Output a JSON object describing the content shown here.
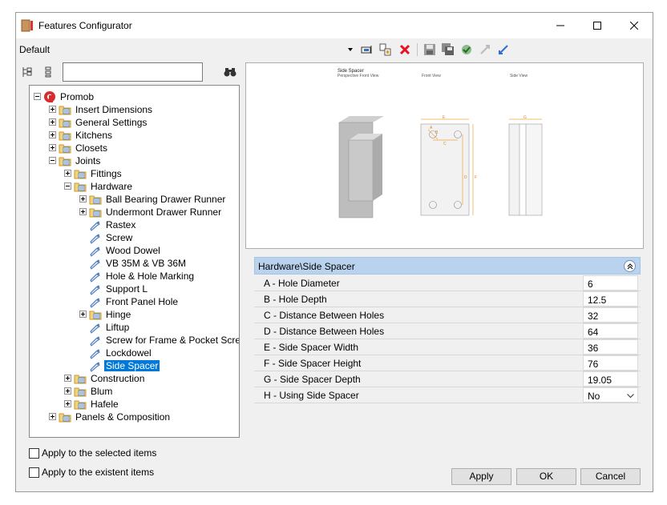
{
  "window": {
    "title": "Features Configurator",
    "minimize_icon": "minimize-icon",
    "maximize_icon": "maximize-icon",
    "close_icon": "close-icon"
  },
  "toolbar": {
    "profile": "Default",
    "icons": [
      "dropdown-arrow-icon",
      "add-icon",
      "copy-icon",
      "delete-icon",
      "save-icon",
      "save-all-icon",
      "check-icon",
      "collapse-icon",
      "expand-icon"
    ]
  },
  "left_toolbar": {
    "icons": [
      "tree-expand-icon",
      "tree-list-icon",
      "binoculars-icon"
    ],
    "search_value": ""
  },
  "tree": {
    "items": [
      {
        "label": "Promob",
        "level": 0,
        "expander": "minus",
        "icon": "promob-icon"
      },
      {
        "label": "Insert Dimensions",
        "level": 1,
        "expander": "plus",
        "icon": "folder-icon"
      },
      {
        "label": "General Settings",
        "level": 1,
        "expander": "plus",
        "icon": "folder-icon"
      },
      {
        "label": "Kitchens",
        "level": 1,
        "expander": "plus",
        "icon": "folder-icon"
      },
      {
        "label": "Closets",
        "level": 1,
        "expander": "plus",
        "icon": "folder-icon"
      },
      {
        "label": "Joints",
        "level": 1,
        "expander": "minus",
        "icon": "folder-icon"
      },
      {
        "label": "Fittings",
        "level": 2,
        "expander": "plus",
        "icon": "folder-icon"
      },
      {
        "label": "Hardware",
        "level": 2,
        "expander": "minus",
        "icon": "folder-icon"
      },
      {
        "label": "Ball Bearing Drawer Runner",
        "level": 3,
        "expander": "plus",
        "icon": "folder-icon"
      },
      {
        "label": "Undermont Drawer Runner",
        "level": 3,
        "expander": "plus",
        "icon": "folder-icon"
      },
      {
        "label": "Rastex",
        "level": 3,
        "expander": "",
        "icon": "tag-icon"
      },
      {
        "label": "Screw",
        "level": 3,
        "expander": "",
        "icon": "tag-icon"
      },
      {
        "label": "Wood Dowel",
        "level": 3,
        "expander": "",
        "icon": "tag-icon"
      },
      {
        "label": "VB 35M & VB 36M",
        "level": 3,
        "expander": "",
        "icon": "tag-icon"
      },
      {
        "label": "Hole & Hole Marking",
        "level": 3,
        "expander": "",
        "icon": "tag-icon"
      },
      {
        "label": "Support L",
        "level": 3,
        "expander": "",
        "icon": "tag-icon"
      },
      {
        "label": "Front Panel Hole",
        "level": 3,
        "expander": "",
        "icon": "tag-icon"
      },
      {
        "label": "Hinge",
        "level": 3,
        "expander": "plus",
        "icon": "folder-icon"
      },
      {
        "label": "Liftup",
        "level": 3,
        "expander": "",
        "icon": "tag-icon"
      },
      {
        "label": "Screw for Frame & Pocket Screw",
        "level": 3,
        "expander": "",
        "icon": "tag-icon"
      },
      {
        "label": "Lockdowel",
        "level": 3,
        "expander": "",
        "icon": "tag-icon"
      },
      {
        "label": "Side Spacer",
        "level": 3,
        "expander": "",
        "icon": "tag-icon",
        "selected": true
      },
      {
        "label": "Construction",
        "level": 2,
        "expander": "plus",
        "icon": "folder-icon"
      },
      {
        "label": "Blum",
        "level": 2,
        "expander": "plus",
        "icon": "folder-icon"
      },
      {
        "label": "Hafele",
        "level": 2,
        "expander": "plus",
        "icon": "folder-icon"
      },
      {
        "label": "Panels & Composition",
        "level": 1,
        "expander": "plus",
        "icon": "folder-icon"
      }
    ]
  },
  "preview": {
    "title": "Side Spacer",
    "caption_perspective": "Perspective Front View",
    "caption_front": "Front View",
    "caption_side": "Side View",
    "dim_labels": [
      "A",
      "B",
      "C",
      "D",
      "E",
      "F",
      "G"
    ]
  },
  "properties": {
    "header": "Hardware\\Side Spacer",
    "rows": [
      {
        "name": "A - Hole Diameter",
        "value": "6"
      },
      {
        "name": "B - Hole Depth",
        "value": "12.5"
      },
      {
        "name": "C - Distance Between Holes",
        "value": "32"
      },
      {
        "name": "D - Distance Between Holes",
        "value": "64"
      },
      {
        "name": "E - Side Spacer Width",
        "value": "36"
      },
      {
        "name": "F - Side Spacer Height",
        "value": "76"
      },
      {
        "name": "G - Side Spacer Depth",
        "value": "19.05"
      },
      {
        "name": "H - Using Side Spacer",
        "value": "No",
        "dropdown": true
      }
    ]
  },
  "options": {
    "apply_selected": "Apply to the selected items",
    "apply_existent": "Apply to the existent items"
  },
  "buttons": {
    "apply": "Apply",
    "ok": "OK",
    "cancel": "Cancel"
  },
  "colors": {
    "selection": "#0078d7",
    "header_bg": "#b9d3ee",
    "delete_red": "#e81123",
    "dimension_orange": "#f2a33a"
  }
}
